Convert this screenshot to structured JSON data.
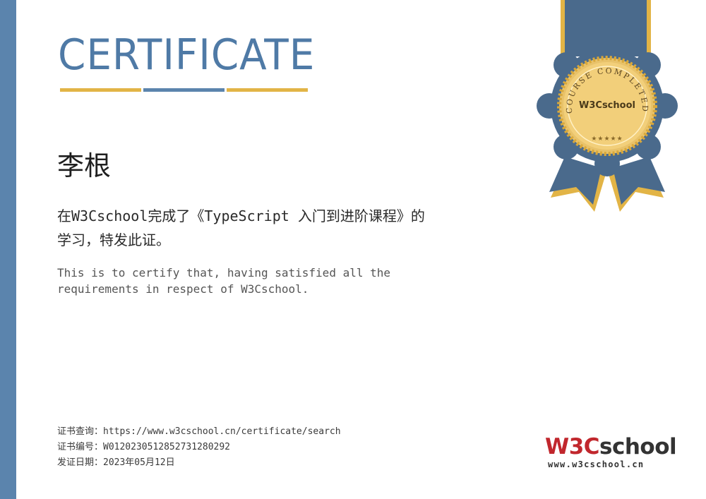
{
  "certificate": {
    "title": "CERTIFICATE",
    "recipient_name": "李根",
    "statement_cn": "在W3Cschool完成了《TypeScript 入门到进阶课程》的学习，特发此证。",
    "statement_en": "This is to certify that, having satisfied all the requirements in respect of W3Cschool."
  },
  "footer": {
    "query_line": "证书查询：https://www.w3cschool.cn/certificate/search",
    "number_line": "证书编号：W0120230512852731280292",
    "date_line": "发证日期：2023年05月12日"
  },
  "seal": {
    "arc_text": "COURSE COMPLETED",
    "center_text": "W3Cschool"
  },
  "brand": {
    "name_part1": "W3C",
    "name_part2": "school",
    "url": "www.w3cschool.cn"
  },
  "colors": {
    "accent_blue": "#5b84ad",
    "accent_gold": "#e2b446",
    "ribbon": "#4a6a8c",
    "brand_red": "#c1272d"
  }
}
